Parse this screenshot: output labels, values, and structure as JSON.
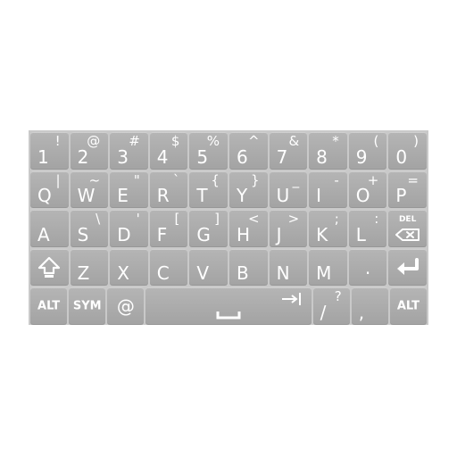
{
  "rows": [
    [
      {
        "main": "1",
        "alt": "!"
      },
      {
        "main": "2",
        "alt": "@"
      },
      {
        "main": "3",
        "alt": "#"
      },
      {
        "main": "4",
        "alt": "$"
      },
      {
        "main": "5",
        "alt": "%"
      },
      {
        "main": "6",
        "alt": "^"
      },
      {
        "main": "7",
        "alt": "&"
      },
      {
        "main": "8",
        "alt": "*"
      },
      {
        "main": "9",
        "alt": "("
      },
      {
        "main": "0",
        "alt": ")"
      }
    ],
    [
      {
        "main": "Q",
        "alt": "|"
      },
      {
        "main": "W",
        "alt": "~"
      },
      {
        "main": "E",
        "alt": "\""
      },
      {
        "main": "R",
        "alt": "`"
      },
      {
        "main": "T",
        "alt": "{"
      },
      {
        "main": "Y",
        "alt": "}"
      },
      {
        "main": "U",
        "alt": "_"
      },
      {
        "main": "I",
        "alt": "-"
      },
      {
        "main": "O",
        "alt": "+"
      },
      {
        "main": "P",
        "alt": "="
      }
    ],
    [
      {
        "main": "A",
        "alt": ""
      },
      {
        "main": "S",
        "alt": "\\"
      },
      {
        "main": "D",
        "alt": "'"
      },
      {
        "main": "F",
        "alt": "["
      },
      {
        "main": "G",
        "alt": "]"
      },
      {
        "main": "H",
        "alt": "<"
      },
      {
        "main": "J",
        "alt": ">"
      },
      {
        "main": "K",
        "alt": ";"
      },
      {
        "main": "L",
        "alt": ":"
      }
    ],
    [
      {
        "main": "Z",
        "alt": ""
      },
      {
        "main": "X",
        "alt": ""
      },
      {
        "main": "C",
        "alt": ""
      },
      {
        "main": "V",
        "alt": ""
      },
      {
        "main": "B",
        "alt": ""
      },
      {
        "main": "N",
        "alt": ""
      },
      {
        "main": "M",
        "alt": ""
      },
      {
        "main": ".",
        "alt": ""
      }
    ]
  ],
  "del_label": "DEL",
  "bottom": {
    "alt_left": "ALT",
    "sym": "SYM",
    "at": "@",
    "slash": "/",
    "slash_alt": "?",
    "comma": ",",
    "alt_right": "ALT"
  },
  "icons": {
    "shift": "shift-icon",
    "backspace": "backspace-icon",
    "enter": "enter-icon",
    "space": "space-icon",
    "tab": "tab-icon"
  },
  "colors": {
    "key_top": "#b5b5b5",
    "key_bottom": "#a3a3a3",
    "keyboard_bg": "#c9c9c9",
    "glyph": "#ffffff"
  }
}
